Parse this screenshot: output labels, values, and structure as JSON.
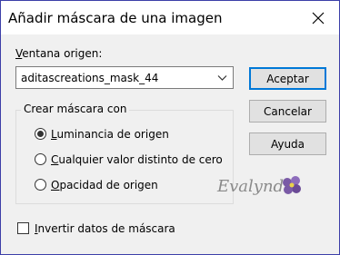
{
  "window": {
    "title": "Añadir máscara de una imagen"
  },
  "source": {
    "label_prefix": "V",
    "label_rest": "entana origen:",
    "selected_value": "aditascreations_mask_44"
  },
  "buttons": {
    "accept": "Aceptar",
    "cancel": "Cancelar",
    "help": "Ayuda"
  },
  "create_group": {
    "title": "Crear máscara con",
    "options": [
      {
        "mnemonic": "L",
        "rest": "uminancia de origen",
        "selected": true
      },
      {
        "mnemonic": "C",
        "rest": "ualquier valor distinto de cero",
        "selected": false
      },
      {
        "mnemonic": "O",
        "rest": "pacidad de origen",
        "selected": false
      }
    ]
  },
  "invert": {
    "mnemonic": "I",
    "rest": "nvertir datos de máscara",
    "checked": false
  },
  "watermark": {
    "text": "Evalynda"
  },
  "colors": {
    "focus_border": "#0078d7",
    "window_border": "#3c3fa8",
    "watermark_purple": "#7a5aa6"
  },
  "icons": {
    "close": "close-icon",
    "dropdown": "chevron-down-icon",
    "watermark": "violet-flower-icon"
  }
}
